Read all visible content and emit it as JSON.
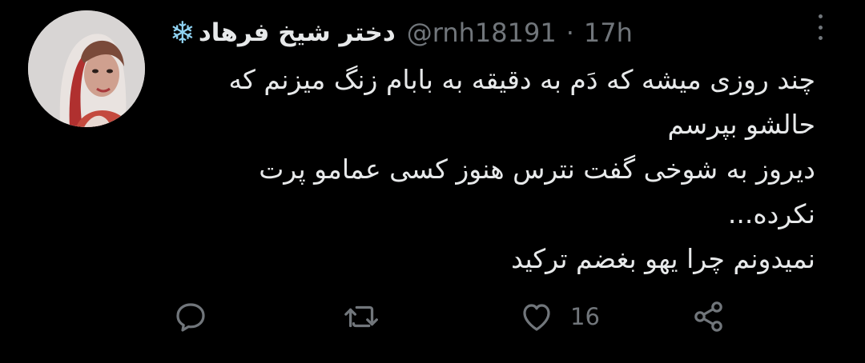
{
  "tweet": {
    "display_name": "دختر شیخ فرهاد",
    "name_emoji": "❄",
    "handle": "@rnh18191",
    "separator": "·",
    "time": "17h",
    "text_lines": [
      "چند روزی میشه که دَم به دقیقه به بابام زنگ میزنم که",
      "حالشو بپرسم",
      "دیروز به شوخی گفت نترس هنوز کسی عمامو پرت",
      "نکرده...",
      "نمیدونم چرا یهو بغضم ترکید"
    ]
  },
  "actions": {
    "reply_icon": "reply-icon",
    "retweet_icon": "retweet-icon",
    "like_icon": "heart-icon",
    "like_count": "16",
    "share_icon": "share-icon"
  },
  "colors": {
    "background": "#000000",
    "text": "#e7e9ea",
    "secondary": "#71767b",
    "snowflake": "#8fd2f2"
  }
}
